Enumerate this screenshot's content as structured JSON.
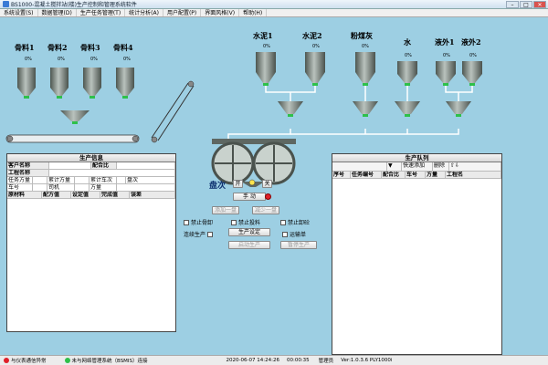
{
  "window": {
    "title": "BS1000-混凝土搅拌站(楼)生产控制和管理系统软件"
  },
  "menu": [
    "系统设置(S)",
    "数据管理(D)",
    "生产任务管理(T)",
    "统计分析(A)",
    "用户配置(P)",
    "界面风格(V)",
    "帮助(H)"
  ],
  "aggregates": [
    {
      "label": "骨料1",
      "pct": "0%"
    },
    {
      "label": "骨料2",
      "pct": "0%"
    },
    {
      "label": "骨料3",
      "pct": "0%"
    },
    {
      "label": "骨料4",
      "pct": "0%"
    }
  ],
  "silos": [
    {
      "label": "水泥1",
      "pct": "0%"
    },
    {
      "label": "水泥2",
      "pct": "0%"
    },
    {
      "label": "粉煤灰",
      "pct": "0%"
    },
    {
      "label": "水",
      "pct": "0%"
    },
    {
      "label": "液外1",
      "pct": "0%"
    },
    {
      "label": "液外2",
      "pct": "0%"
    }
  ],
  "mixer": {
    "batch_label": "盘次",
    "open_label": "开",
    "close_label": "关",
    "mode_label": "手 动"
  },
  "production_info": {
    "title": "生产信息",
    "customer_label": "客户名称",
    "mix_label": "配合比",
    "project_label": "工程名称",
    "task_qty_label": "任务方量",
    "cum_qty_label": "累计方量",
    "cum_trucks_label": "累计车次",
    "batch_label": "盘次",
    "vehicle_label": "车号",
    "driver_label": "司机",
    "qty_label": "方量",
    "cols": [
      "原材料",
      "配方值",
      "设定值",
      "完成值",
      "误差"
    ]
  },
  "controls": {
    "add_batch": "添加一盘",
    "reduce_batch": "减少一盘",
    "stop_aggregate": "禁止骨卸",
    "stop_powder": "禁止投料",
    "stop_discharge": "禁止卸砼",
    "continuous": "连续生产",
    "prod_setting": "生产设定",
    "transport": "运输单",
    "start": "启动生产",
    "pause": "暂停生产"
  },
  "queue": {
    "title": "生产队列",
    "quick_add": "快速添加",
    "delete": "删除",
    "cols": [
      "序号",
      "任务编号",
      "配合比",
      "车号",
      "方量",
      "工程名"
    ]
  },
  "status": {
    "left": "与仪表通信异常",
    "middle": "未与网络管理系统（BSMIS）连接",
    "datetime": "2020-06-07 14:24:26",
    "timer": "00:00:35",
    "user": "管理员",
    "version": "Ver:1.0.3.6 PLY1000i"
  },
  "colors": {
    "bg": "#9dcfe3",
    "hopper": "#6f7a74",
    "indicator": "#2ec04a"
  }
}
